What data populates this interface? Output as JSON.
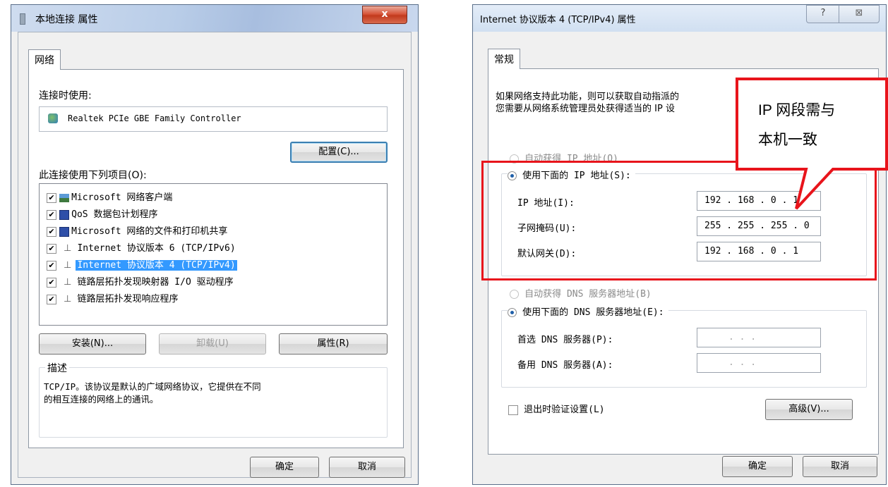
{
  "win1": {
    "title": "本地连接 属性",
    "tab": "网络",
    "connect_using_label": "连接时使用:",
    "adapter_name": "Realtek PCIe GBE Family Controller",
    "configure_button": "配置(C)...",
    "items_label": "此连接使用下列项目(O):",
    "items": [
      {
        "label": "Microsoft 网络客户端",
        "checked": true,
        "icon": "network-client-icon"
      },
      {
        "label": "QoS 数据包计划程序",
        "checked": true,
        "icon": "qos-icon"
      },
      {
        "label": "Microsoft 网络的文件和打印机共享",
        "checked": true,
        "icon": "file-sharing-icon"
      },
      {
        "label": "Internet 协议版本 6 (TCP/IPv6)",
        "checked": true,
        "icon": "protocol-icon"
      },
      {
        "label": "Internet 协议版本 4 (TCP/IPv4)",
        "checked": true,
        "icon": "protocol-icon",
        "selected": true
      },
      {
        "label": "链路层拓扑发现映射器 I/O 驱动程序",
        "checked": true,
        "icon": "protocol-icon"
      },
      {
        "label": "链路层拓扑发现响应程序",
        "checked": true,
        "icon": "protocol-icon"
      }
    ],
    "install_button": "安装(N)...",
    "uninstall_button": "卸载(U)",
    "properties_button": "属性(R)",
    "description_title": "描述",
    "description_text_1": "TCP/IP。该协议是默认的广域网络协议，它提供在不同",
    "description_text_2": "的相互连接的网络上的通讯。",
    "ok_button": "确定",
    "cancel_button": "取消"
  },
  "win2": {
    "title": "Internet 协议版本 4 (TCP/IPv4) 属性",
    "help_glyph": "?",
    "close_glyph": "⊠",
    "tab": "常规",
    "intro_line_1": "如果网络支持此功能，则可以获取自动指派的",
    "intro_line_2": "您需要从网络系统管理员处获得适当的 IP 设",
    "auto_ip": "自动获得 IP 地址(O)",
    "manual_ip": "使用下面的 IP 地址(S):",
    "ip_label": "IP 地址(I):",
    "ip_value": "192 . 168 .  0  . 17",
    "mask_label": "子网掩码(U):",
    "mask_value": "255 . 255 . 255 .  0",
    "gateway_label": "默认网关(D):",
    "gateway_value": "192 . 168 .  0  .  1",
    "auto_dns": "自动获得 DNS 服务器地址(B)",
    "manual_dns": "使用下面的 DNS 服务器地址(E):",
    "preferred_dns_label": "首选 DNS 服务器(P):",
    "alternate_dns_label": "备用 DNS 服务器(A):",
    "dns_placeholder": ".      .      .",
    "validate_on_exit": "退出时验证设置(L)",
    "advanced_button": "高级(V)...",
    "ok_button": "确定",
    "cancel_button": "取消"
  },
  "callout": {
    "line_1": "IP 网段需与",
    "line_2": "本机一致",
    "color": "#e8141b"
  }
}
